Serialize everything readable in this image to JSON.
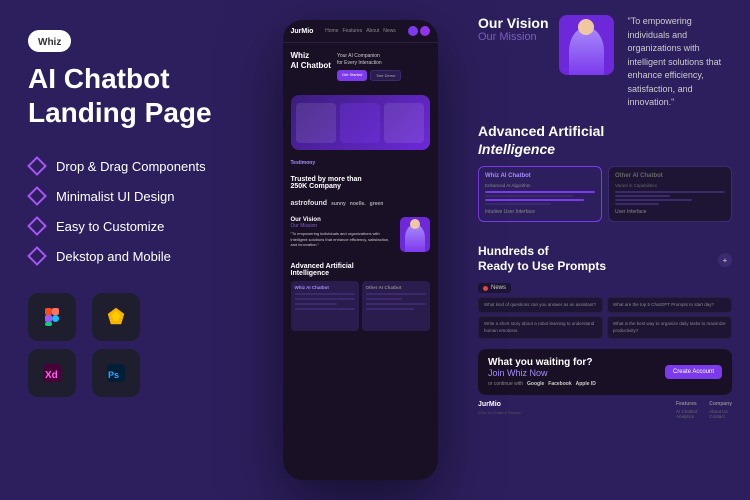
{
  "brand": {
    "name": "Whiz",
    "badge": "Whiz"
  },
  "left": {
    "title": "AI Chatbot\nLanding Page",
    "features": [
      {
        "id": "feat1",
        "label": "Drop & Drag Components"
      },
      {
        "id": "feat2",
        "label": "Minimalist UI Design"
      },
      {
        "id": "feat3",
        "label": "Easy to Customize"
      },
      {
        "id": "feat4",
        "label": "Dekstop and Mobile"
      }
    ],
    "tools": [
      {
        "id": "figma",
        "symbol": "🎨",
        "label": "Figma"
      },
      {
        "id": "sketch",
        "symbol": "💎",
        "label": "Sketch"
      },
      {
        "id": "xd",
        "symbol": "✦",
        "label": "XD"
      },
      {
        "id": "ps",
        "symbol": "🖌",
        "label": "Photoshop"
      }
    ]
  },
  "phone": {
    "nav_logo": "JurMio",
    "nav_links": [
      "Home",
      "Features",
      "About",
      "News"
    ],
    "hero_title": "Whiz\nAI Chatbot",
    "hero_subtitle": "Your AI Companion\nfor Every Interaction",
    "section_trusted": "Trusted by more than\n250K Company",
    "brands": [
      "astrofound",
      "sunny",
      "noelle.",
      "green"
    ],
    "vision_label": "Our Vision",
    "mission_label": "Our Mission",
    "vision_quote": "\"To empowering\nindividuals and\norganizations with\nintelligent solutions\nthat enhance\nefficiency, satisfaction,\nand innovation.\"",
    "ai_title": "Advanced Artificial\nIntelligence",
    "ai_cards": [
      {
        "title": "Whiz AI Chatbot",
        "lines": 4
      },
      {
        "title": "Other AI Chatbot",
        "lines": 4
      }
    ]
  },
  "right": {
    "vision_title": "Our Vision",
    "mission_label": "Our Mission",
    "vision_quote": "\"To empowering\nindividuals and\norganizations with\nintelligent solutions\nthat enhance\nefficiency, satisfaction,\nand innovation.\"",
    "ai_title": "Advanced Artificial",
    "ai_intelligence": "Intelligence",
    "ai_cards": [
      {
        "title": "Whiz AI Chatbot",
        "label": "Enhanced AI Algorithm"
      },
      {
        "title": "Other AI Chatbot",
        "label": "Varied in Capabilities"
      }
    ],
    "prompts_section_title": "Hundreds of",
    "prompts_section_sub": "Ready to Use Prompts",
    "news_label": "News",
    "prompts": [
      "What kind of questions can you answer as an assistant?",
      "What are the top 5 ChatGPT Prompts to start day with good morning?",
      "Write a short story about a robot learning to understand human emotions.",
      "What is the best way to organize daily tasks to maximize productivity?"
    ],
    "join_title": "What you waiting for?",
    "join_subtitle": "Join Whiz Now",
    "join_btn": "Create Account",
    "social_continue": "or continue with",
    "social_options": [
      "Google",
      "Facebook",
      "Apple ID"
    ],
    "footer_brand": "JurMio",
    "footer_cols": [
      {
        "title": "Features",
        "links": [
          "AI Chatbot",
          "Analytics"
        ]
      },
      {
        "title": "Company",
        "links": [
          "About Us",
          "Contact"
        ]
      }
    ]
  },
  "colors": {
    "bg": "#2d1f5e",
    "accent": "#7c3aed",
    "light_accent": "#a78bfa",
    "dark_card": "#1e1535",
    "text_white": "#ffffff",
    "text_muted": "#888888"
  }
}
